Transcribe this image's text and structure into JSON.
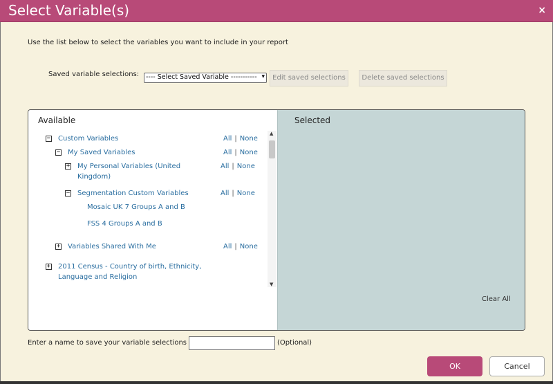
{
  "dialog": {
    "title": "Select Variable(s)",
    "close_glyph": "×",
    "instructions": "Use the list below to select the variables you want to include in your report"
  },
  "saved": {
    "label": "Saved variable selections:",
    "select_value": "---- Select Saved Variable -----------",
    "edit_label": "Edit saved selections",
    "delete_label": "Delete saved selections"
  },
  "available": {
    "header": "Available",
    "all_label": "All",
    "none_label": "None",
    "items": [
      {
        "label": "Custom Variables",
        "toggle": "−"
      },
      {
        "label": "My Saved Variables",
        "toggle": "−"
      },
      {
        "label": "My Personal Variables (United Kingdom)",
        "toggle": "+"
      },
      {
        "label": "Segmentation Custom Variables",
        "toggle": "−"
      },
      {
        "label": "Mosaic UK 7 Groups A and B"
      },
      {
        "label": "FSS 4 Groups A and B"
      },
      {
        "label": "Variables Shared With Me",
        "toggle": "+"
      },
      {
        "label": "2011 Census - Country of birth, Ethnicity, Language and Religion",
        "toggle": "+"
      }
    ]
  },
  "selected": {
    "header": "Selected",
    "clear_all": "Clear All"
  },
  "save_name": {
    "label": "Enter a name to save your variable selections :",
    "value": "",
    "optional": "(Optional)"
  },
  "buttons": {
    "ok": "OK",
    "cancel": "Cancel"
  },
  "colors": {
    "accent": "#b84a78",
    "link": "#2a6ea0",
    "background": "#f7f2de",
    "selected_panel": "#c5d6d6"
  },
  "icons": {
    "collapse": "minus-box-icon",
    "expand": "plus-box-icon",
    "close": "close-icon"
  }
}
